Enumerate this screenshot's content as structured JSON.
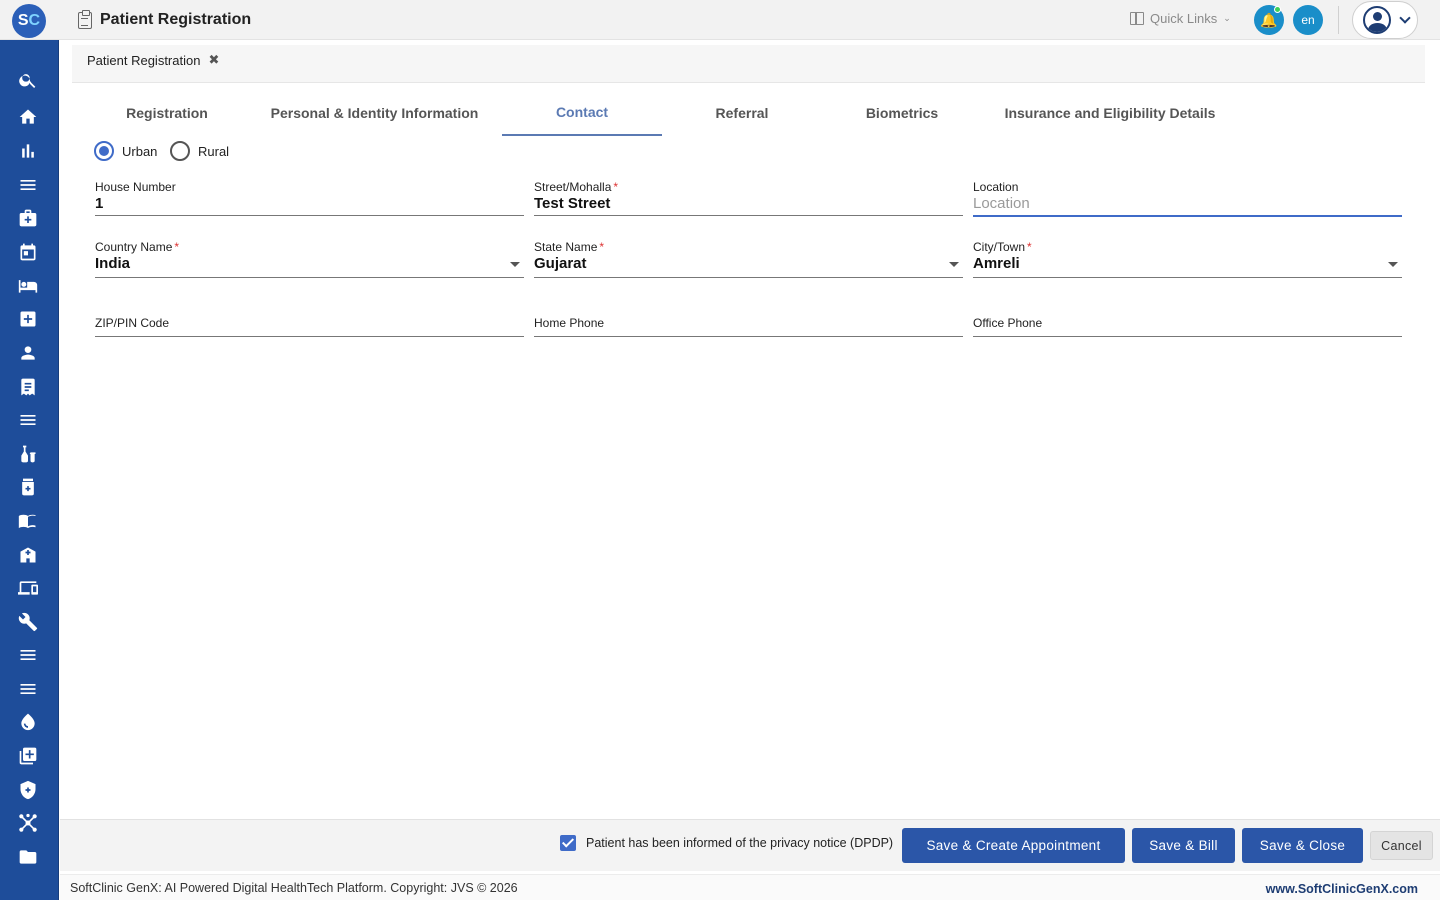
{
  "header": {
    "logo_s": "S",
    "logo_c": "C",
    "title": "Patient Registration",
    "quick_links": "Quick Links",
    "lang": "en"
  },
  "tab_chip": {
    "label": "Patient Registration"
  },
  "tabs": [
    {
      "label": "Registration"
    },
    {
      "label": "Personal & Identity Information"
    },
    {
      "label": "Contact"
    },
    {
      "label": "Referral"
    },
    {
      "label": "Biometrics"
    },
    {
      "label": "Insurance and Eligibility Details"
    }
  ],
  "area_type": {
    "urban": "Urban",
    "rural": "Rural"
  },
  "fields": {
    "house_number": {
      "label": "House Number",
      "value": "1"
    },
    "street": {
      "label": "Street/Mohalla",
      "value": "Test Street",
      "required": "*"
    },
    "location": {
      "label": "Location",
      "placeholder": "Location"
    },
    "country": {
      "label": "Country Name",
      "value": "India",
      "required": "*"
    },
    "state": {
      "label": "State Name",
      "value": "Gujarat",
      "required": "*"
    },
    "city": {
      "label": "City/Town",
      "value": "Amreli",
      "required": "*"
    },
    "zip": {
      "label": "ZIP/PIN Code",
      "value": ""
    },
    "home_phone": {
      "label": "Home Phone",
      "value": ""
    },
    "office_phone": {
      "label": "Office Phone",
      "value": ""
    }
  },
  "actions": {
    "consent": "Patient has been informed of the privacy notice (DPDP)",
    "save_appointment": "Save & Create Appointment",
    "save_bill": "Save & Bill",
    "save_close": "Save & Close",
    "cancel": "Cancel"
  },
  "footer": {
    "copyright": "SoftClinic GenX: AI Powered Digital HealthTech Platform. Copyright: JVS © 2026",
    "site": "www.SoftClinicGenX.com"
  },
  "colors": {
    "sidebar": "#1e4d9a",
    "accent": "#3f6bc8",
    "button": "#2b56a8"
  },
  "sidebar_icons": [
    "search-icon",
    "home-icon",
    "bar-chart-icon",
    "menu-icon",
    "medical-bag-icon",
    "calendar-icon",
    "bed-icon",
    "medical-plus-icon",
    "person-icon",
    "receipt-icon",
    "menu-icon",
    "lab-icon",
    "medicine-icon",
    "book-icon",
    "hospital-icon",
    "devices-icon",
    "wrench-icon",
    "menu-icon",
    "menu-icon",
    "drop-icon",
    "add-box-icon",
    "shield-icon",
    "hub-icon",
    "folder-icon"
  ]
}
